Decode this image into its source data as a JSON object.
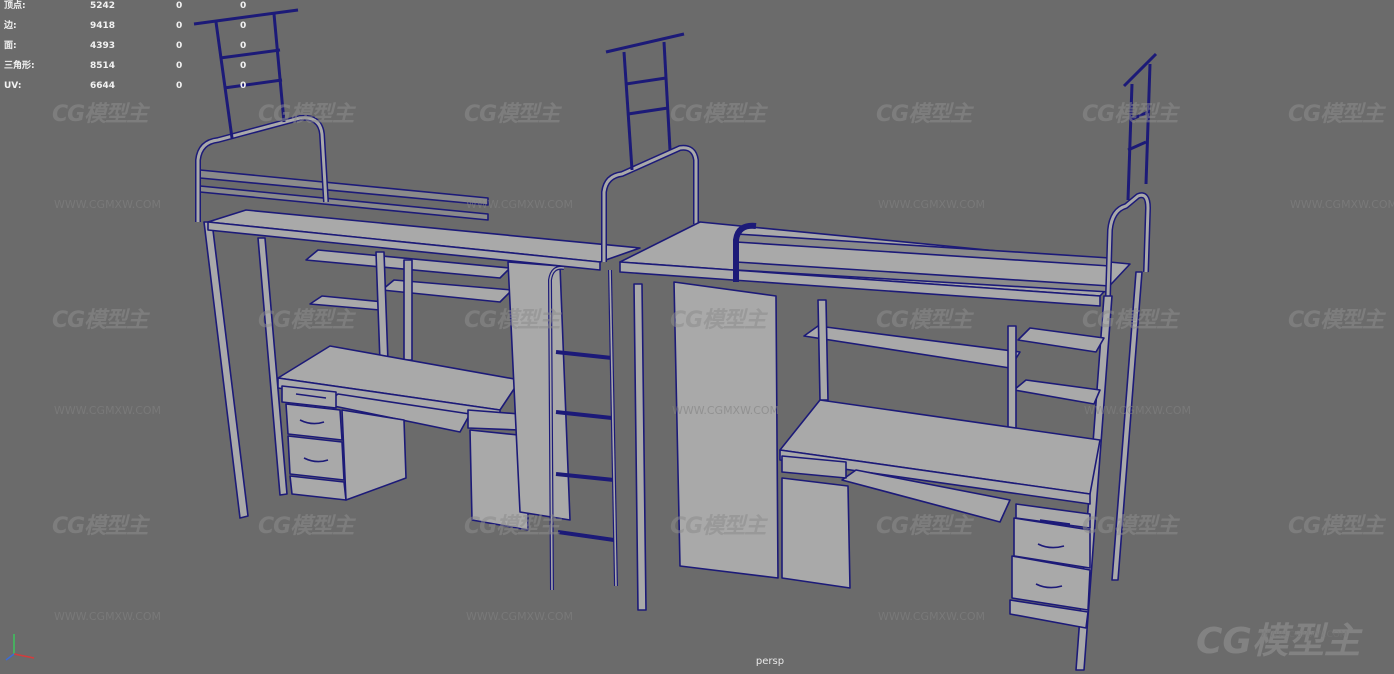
{
  "stats": {
    "rows": [
      {
        "label": "顶点:",
        "total": "5242",
        "sel1": "0",
        "sel2": "0"
      },
      {
        "label": "边:",
        "total": "9418",
        "sel1": "0",
        "sel2": "0"
      },
      {
        "label": "面:",
        "total": "4393",
        "sel1": "0",
        "sel2": "0"
      },
      {
        "label": "三角形:",
        "total": "8514",
        "sel1": "0",
        "sel2": "0"
      },
      {
        "label": "UV:",
        "total": "6644",
        "sel1": "0",
        "sel2": "0"
      }
    ]
  },
  "viewport": {
    "camera_label": "persp",
    "background": "#6b6b6b",
    "wire_color": "#1c1a78",
    "surface_color": "#a9a9a9"
  },
  "watermark": {
    "logo": "CG模型主",
    "url": "WWW.CGMXW.COM"
  },
  "axis": {
    "x_color": "#d43c3c",
    "y_color": "#3cc45c",
    "z_color": "#3c6cd4"
  }
}
